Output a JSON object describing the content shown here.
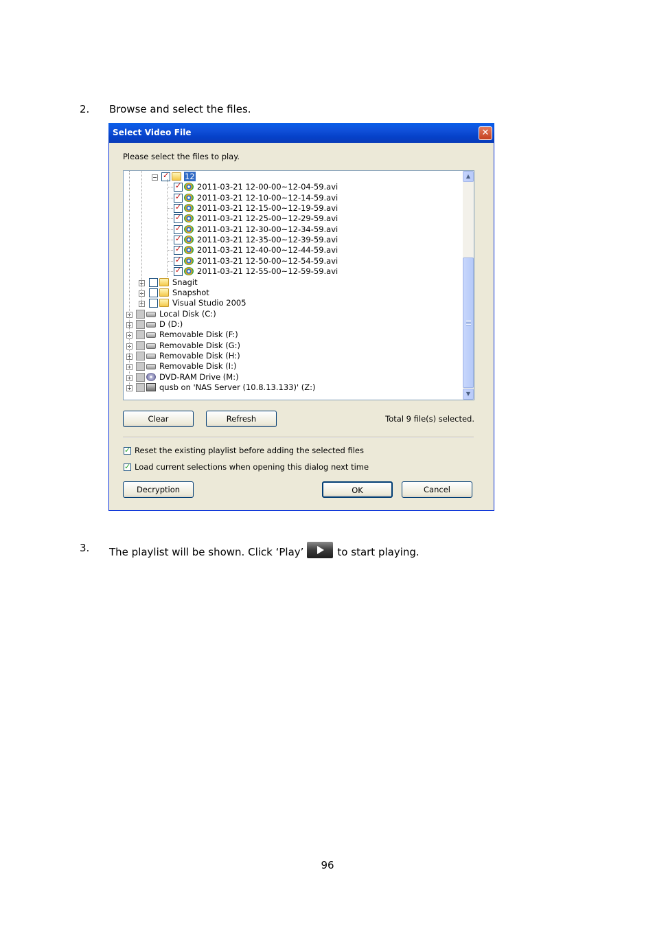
{
  "steps": [
    {
      "number": "2.",
      "text": "Browse and select the files."
    },
    {
      "number": "3.",
      "text_before": "The playlist will be shown.   Click ‘Play’",
      "text_after": "to start playing."
    }
  ],
  "play_icon": "play-button-icon",
  "page_number": "96",
  "dialog": {
    "title": "Select Video File",
    "close_label": "✕",
    "prompt": "Please select the files to play.",
    "tree": {
      "selected_folder": "12",
      "files": [
        "2011-03-21 12-00-00~12-04-59.avi",
        "2011-03-21 12-10-00~12-14-59.avi",
        "2011-03-21 12-15-00~12-19-59.avi",
        "2011-03-21 12-25-00~12-29-59.avi",
        "2011-03-21 12-30-00~12-34-59.avi",
        "2011-03-21 12-35-00~12-39-59.avi",
        "2011-03-21 12-40-00~12-44-59.avi",
        "2011-03-21 12-50-00~12-54-59.avi",
        "2011-03-21 12-55-00~12-59-59.avi"
      ],
      "folders": [
        "Snagit",
        "Snapshot",
        "Visual Studio 2005"
      ],
      "drives": [
        {
          "name": "Local Disk (C:)",
          "icon": "disk-icon"
        },
        {
          "name": "D (D:)",
          "icon": "disk-icon"
        },
        {
          "name": "Removable Disk (F:)",
          "icon": "disk-icon"
        },
        {
          "name": "Removable Disk (G:)",
          "icon": "disk-icon"
        },
        {
          "name": "Removable Disk (H:)",
          "icon": "disk-icon"
        },
        {
          "name": "Removable Disk (I:)",
          "icon": "disk-icon"
        },
        {
          "name": "DVD-RAM Drive (M:)",
          "icon": "dvd-icon"
        },
        {
          "name": "qusb on 'NAS Server (10.8.13.133)' (Z:)",
          "icon": "network-drive-icon"
        }
      ]
    },
    "buttons": {
      "clear": "Clear",
      "refresh": "Refresh",
      "decryption": "Decryption",
      "ok": "OK",
      "cancel": "Cancel"
    },
    "total_selected": "Total 9 file(s) selected.",
    "options": {
      "reset_playlist": "Reset the existing playlist before adding the selected files",
      "load_selections": "Load current selections when opening this dialog next time"
    }
  }
}
